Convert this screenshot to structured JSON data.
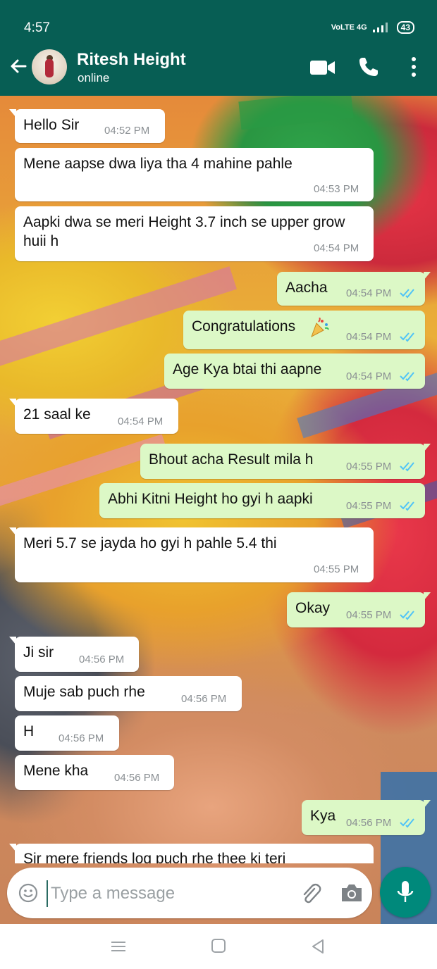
{
  "status_bar": {
    "time": "4:57",
    "network": "VoLTE 4G",
    "battery": "43"
  },
  "header": {
    "contact_name": "Ritesh Height",
    "contact_status": "online",
    "icons": [
      "back-arrow-icon",
      "video-call-icon",
      "phone-icon",
      "more-vert-icon"
    ]
  },
  "messages": [
    {
      "direction": "in",
      "text": "Hello Sir",
      "time": "04:52 PM"
    },
    {
      "direction": "in",
      "text": "Mene aapse dwa liya tha 4 mahine pahle",
      "time": "04:53 PM"
    },
    {
      "direction": "in",
      "text": "Aapki dwa se meri Height 3.7 inch se upper grow huii h",
      "time": "04:54 PM"
    },
    {
      "direction": "out",
      "text": "Aacha",
      "time": "04:54 PM",
      "status": "read"
    },
    {
      "direction": "out",
      "text": "Congratulations",
      "time": "04:54 PM",
      "status": "read",
      "emoji": "party-popper"
    },
    {
      "direction": "out",
      "text": "Age Kya btai thi aapne",
      "time": "04:54 PM",
      "status": "read"
    },
    {
      "direction": "in",
      "text": "21 saal ke",
      "time": "04:54 PM"
    },
    {
      "direction": "out",
      "text": "Bhout acha Result mila h",
      "time": "04:55 PM",
      "status": "read"
    },
    {
      "direction": "out",
      "text": "Abhi Kitni Height ho gyi h aapki",
      "time": "04:55 PM",
      "status": "read"
    },
    {
      "direction": "in",
      "text": "Meri 5.7 se jayda ho gyi h pahle 5.4 thi",
      "time": "04:55 PM"
    },
    {
      "direction": "out",
      "text": "Okay",
      "time": "04:55 PM",
      "status": "read"
    },
    {
      "direction": "in",
      "text": "Ji sir",
      "time": "04:56 PM"
    },
    {
      "direction": "in",
      "text": "Muje sab puch rhe",
      "time": "04:56 PM"
    },
    {
      "direction": "in",
      "text": "H",
      "time": "04:56 PM"
    },
    {
      "direction": "in",
      "text": "Mene kha",
      "time": "04:56 PM"
    },
    {
      "direction": "out",
      "text": "Kya",
      "time": "04:56 PM",
      "status": "read"
    },
    {
      "direction": "in",
      "text": "Sir mere friends log puch rhe thee ki teri",
      "time": ""
    }
  ],
  "composer": {
    "placeholder": "Type a message",
    "value": ""
  },
  "colors": {
    "header": "#075e54",
    "outgoing_bubble": "#dcf8c6",
    "incoming_bubble": "#ffffff",
    "read_ticks": "#4fc3f7",
    "mic_button": "#00897b"
  }
}
